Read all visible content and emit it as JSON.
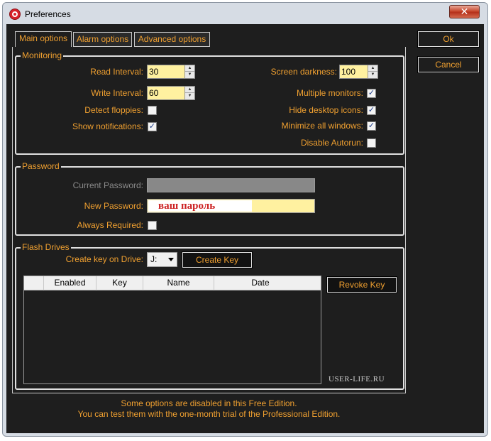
{
  "window": {
    "title": "Preferences",
    "close_glyph": "✕"
  },
  "tabs": [
    {
      "label": "Main options"
    },
    {
      "label": "Alarm options"
    },
    {
      "label": "Advanced options"
    }
  ],
  "buttons": {
    "ok": "Ok",
    "cancel": "Cancel"
  },
  "monitoring": {
    "title": "Monitoring",
    "read_interval_label": "Read Interval:",
    "read_interval_value": "30",
    "write_interval_label": "Write Interval:",
    "write_interval_value": "60",
    "detect_floppies_label": "Detect floppies:",
    "detect_floppies_checked": false,
    "show_notifications_label": "Show notifications:",
    "show_notifications_checked": true,
    "screen_darkness_label": "Screen darkness:",
    "screen_darkness_value": "100",
    "multiple_monitors_label": "Multiple monitors:",
    "multiple_monitors_checked": true,
    "hide_desktop_icons_label": "Hide desktop icons:",
    "hide_desktop_icons_checked": true,
    "minimize_all_windows_label": "Minimize all windows:",
    "minimize_all_windows_checked": true,
    "disable_autorun_label": "Disable Autorun:",
    "disable_autorun_checked": false
  },
  "password": {
    "title": "Password",
    "current_label": "Current Password:",
    "new_label": "New Password:",
    "new_overlay_text": "ваш пароль",
    "always_required_label": "Always Required:",
    "always_required_checked": false
  },
  "flash_drives": {
    "title": "Flash Drives",
    "create_key_label": "Create key on Drive:",
    "drive_value": "J:",
    "create_key_button": "Create Key",
    "revoke_key_button": "Revoke Key",
    "columns": [
      "Enabled",
      "Key",
      "Name",
      "Date"
    ],
    "rows": []
  },
  "watermark": "USER-LIFE.RU",
  "notice": {
    "line1": "Some options are disabled in this Free Edition.",
    "line2": "You can test them with the one-month trial of the Professional Edition."
  },
  "icons": {
    "app": "app-logo-icon",
    "close": "close-icon",
    "check": "✓"
  }
}
